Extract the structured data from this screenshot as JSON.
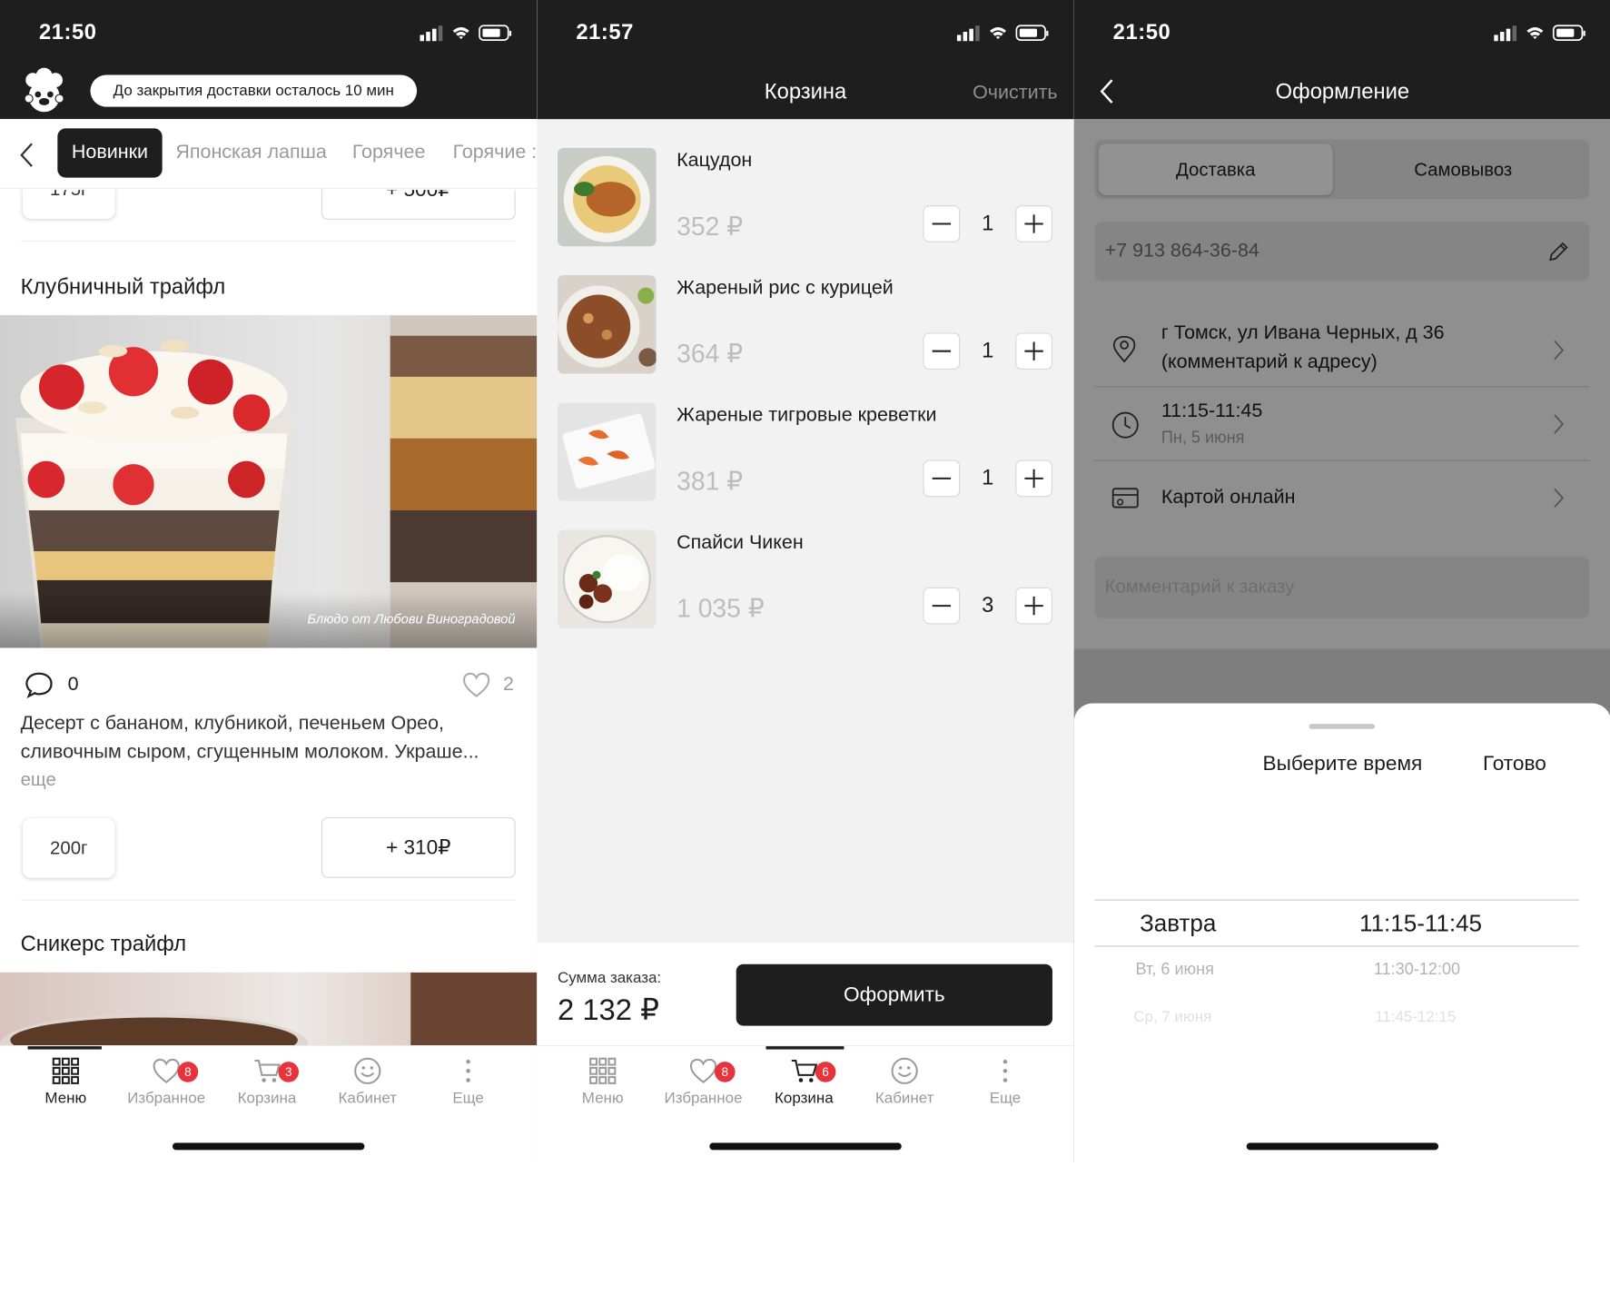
{
  "screen1": {
    "status_time": "21:50",
    "delivery_notice": "До закрытия доставки осталось 10 мин",
    "categories": [
      "Новинки",
      "Японская лапша",
      "Горячее",
      "Горячие :"
    ],
    "prev_weight": "175г",
    "prev_price": "+ 500₽",
    "product_title": "Клубничный трайфл",
    "photo_caption": "Блюдо от Любови Виноградовой",
    "comments_count": "0",
    "likes_count": "2",
    "description": "Десерт с бананом, клубникой, печеньем Орео, сливочным сыром, сгущенным молоком. Украше...",
    "more_link": "еще",
    "weight": "200г",
    "price_button": "+ 310₽",
    "next_title": "Сникерс трайфл",
    "tabs": [
      {
        "label": "Меню",
        "badge": ""
      },
      {
        "label": "Избранное",
        "badge": "8"
      },
      {
        "label": "Корзина",
        "badge": "3"
      },
      {
        "label": "Кабинет",
        "badge": ""
      },
      {
        "label": "Еще",
        "badge": ""
      }
    ]
  },
  "screen2": {
    "status_time": "21:57",
    "title": "Корзина",
    "clear": "Очистить",
    "items": [
      {
        "name": "Кацудон",
        "price": "352 ₽",
        "qty": "1"
      },
      {
        "name": "Жареный рис с курицей",
        "price": "364 ₽",
        "qty": "1"
      },
      {
        "name": "Жареные тигровые креветки",
        "price": "381 ₽",
        "qty": "1"
      },
      {
        "name": "Спайси Чикен",
        "price": "1 035 ₽",
        "qty": "3"
      }
    ],
    "total_label": "Сумма заказа:",
    "total_value": "2 132 ₽",
    "checkout": "Оформить",
    "tabs": [
      {
        "label": "Меню",
        "badge": ""
      },
      {
        "label": "Избранное",
        "badge": "8"
      },
      {
        "label": "Корзина",
        "badge": "6"
      },
      {
        "label": "Кабинет",
        "badge": ""
      },
      {
        "label": "Еще",
        "badge": ""
      }
    ]
  },
  "screen3": {
    "status_time": "21:50",
    "title": "Оформление",
    "segment_delivery": "Доставка",
    "segment_pickup": "Самовывоз",
    "phone": "+7 913 864-36-84",
    "address_line1": "г Томск, ул Ивана Черных, д 36",
    "address_line2": "(комментарий к адресу)",
    "time_slot": "11:15-11:45",
    "time_date": "Пн, 5 июня",
    "payment": "Картой онлайн",
    "comment_placeholder": "Комментарий к заказу",
    "sheet_title": "Выберите время",
    "sheet_done": "Готово",
    "picker": [
      {
        "day": "Завтра",
        "slot": "11:15-11:45"
      },
      {
        "day": "Вт, 6 июня",
        "slot": "11:30-12:00"
      },
      {
        "day": "Ср, 7 июня",
        "slot": "11:45-12:15"
      }
    ]
  },
  "colors": {
    "dark": "#1e1e1e",
    "badge": "#e8323c",
    "muted": "#9a9a9a"
  }
}
